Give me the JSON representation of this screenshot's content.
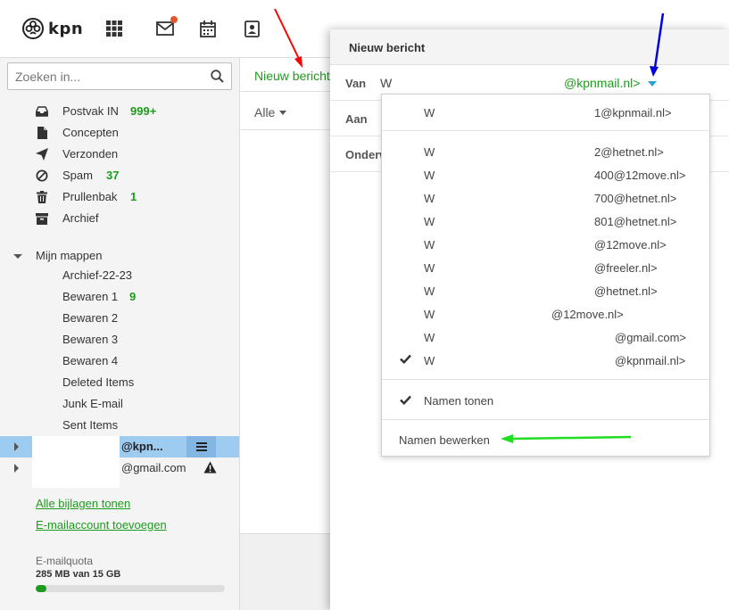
{
  "brand": {
    "logo_text": "kpn",
    "accent": "#1d9b1d",
    "notif_color": "#e4572e"
  },
  "topbar": {
    "icons": [
      "apps-grid-icon",
      "mail-icon",
      "calendar-icon",
      "contacts-icon"
    ]
  },
  "sidebar": {
    "search_placeholder": "Zoeken in...",
    "folders": [
      {
        "label": "Postvak IN",
        "count": "999+",
        "icon": "inbox-icon"
      },
      {
        "label": "Concepten",
        "count": "",
        "icon": "draft-icon"
      },
      {
        "label": "Verzonden",
        "count": "",
        "icon": "sent-icon"
      },
      {
        "label": "Spam",
        "count": "37",
        "icon": "spam-icon"
      },
      {
        "label": "Prullenbak",
        "count": "1",
        "icon": "trash-icon"
      },
      {
        "label": "Archief",
        "count": "",
        "icon": "archive-icon"
      }
    ],
    "my_folders_label": "Mijn mappen",
    "my_folders": [
      {
        "label": "Archief-22-23",
        "count": ""
      },
      {
        "label": "Bewaren 1",
        "count": "9"
      },
      {
        "label": "Bewaren 2",
        "count": ""
      },
      {
        "label": "Bewaren 3",
        "count": ""
      },
      {
        "label": "Bewaren 4",
        "count": ""
      },
      {
        "label": "Deleted Items",
        "count": ""
      },
      {
        "label": "Junk E-mail",
        "count": ""
      },
      {
        "label": "Sent Items",
        "count": ""
      }
    ],
    "accounts": [
      {
        "label": "@kpn..."
      },
      {
        "label": "@gmail.com"
      }
    ],
    "links": {
      "attachments": "Alle bijlagen tonen",
      "add_account": "E-mailaccount toevoegen"
    },
    "quota": {
      "label": "E-mailquota",
      "text": "285 MB van 15 GB",
      "fraction": 0.019
    }
  },
  "main": {
    "new_message": "Nieuw bericht",
    "filter": "Alle"
  },
  "compose": {
    "title": "Nieuw bericht",
    "van_label": "Van",
    "van_name": "W",
    "van_email": "@kpnmail.nl>",
    "aan_label": "Aan",
    "onderwerp_label": "Onderw"
  },
  "dropdown": {
    "items": [
      {
        "name": "W",
        "email": "1@kpnmail.nl>",
        "checked": false
      },
      {
        "name": "W",
        "email": "2@hetnet.nl>",
        "checked": false
      },
      {
        "name": "W",
        "email": "400@12move.nl>",
        "checked": false
      },
      {
        "name": "W",
        "email": "700@hetnet.nl>",
        "checked": false
      },
      {
        "name": "W",
        "email": "801@hetnet.nl>",
        "checked": false
      },
      {
        "name": "W",
        "email": "@12move.nl>",
        "checked": false
      },
      {
        "name": "W",
        "email": "@freeler.nl>",
        "checked": false
      },
      {
        "name": "W",
        "email": "@hetnet.nl>",
        "checked": false
      },
      {
        "name": "W",
        "email": "@12move.nl>",
        "checked": false
      },
      {
        "name": "W",
        "email": "@gmail.com>",
        "checked": false
      },
      {
        "name": "W",
        "email": "@kpnmail.nl>",
        "checked": true
      }
    ],
    "show_names": "Namen tonen",
    "edit_names": "Namen bewerken"
  },
  "annotations": {
    "arrow_colors": {
      "red": "#ff0000",
      "blue": "#0000e0",
      "green": "#22dd22"
    }
  }
}
